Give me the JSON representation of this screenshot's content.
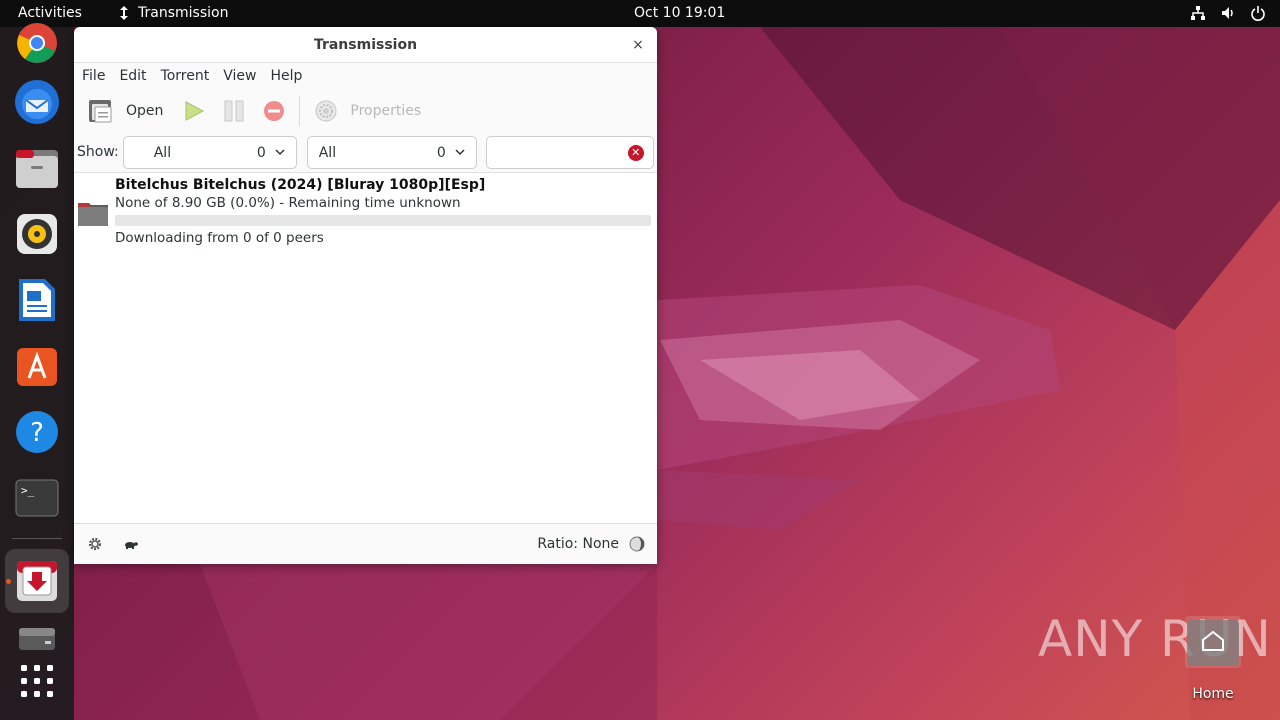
{
  "topbar": {
    "activities": "Activities",
    "app_name": "Transmission",
    "clock": "Oct 10  19:01",
    "tray_icons": [
      "network-icon",
      "volume-icon",
      "power-icon"
    ]
  },
  "dock": {
    "items": [
      "chrome-icon",
      "thunderbird-icon",
      "files-icon",
      "rhythmbox-icon",
      "libreoffice-writer-icon",
      "app-center-icon",
      "help-icon",
      "terminal-icon",
      "transmission-icon",
      "drive-icon",
      "app-grid-icon"
    ],
    "active_item": "transmission-icon"
  },
  "window": {
    "title": "Transmission",
    "close_glyph": "×",
    "menu": [
      "File",
      "Edit",
      "Torrent",
      "View",
      "Help"
    ],
    "toolbar": {
      "open_label": "Open",
      "properties_label": "Properties"
    },
    "filter": {
      "show_label": "Show:",
      "activity_value": "All",
      "activity_count": "0",
      "tracker_value": "All",
      "tracker_count": "0",
      "search_value": ""
    },
    "torrents": [
      {
        "name": "Bitelchus Bitelchus (2024) [Bluray 1080p][Esp]",
        "status": "None of 8.90 GB (0.0%) - Remaining time unknown",
        "progress": 0.0,
        "peers": "Downloading from 0 of 0 peers"
      }
    ],
    "statusbar": {
      "ratio": "Ratio: None"
    }
  },
  "desktop": {
    "home_label": "Home",
    "watermark": "ANY RUN"
  },
  "colors": {
    "accent": "#e95420",
    "topbar": "#0d0d0d",
    "dock": "#1c1c1c",
    "progress": "#3584e4"
  }
}
